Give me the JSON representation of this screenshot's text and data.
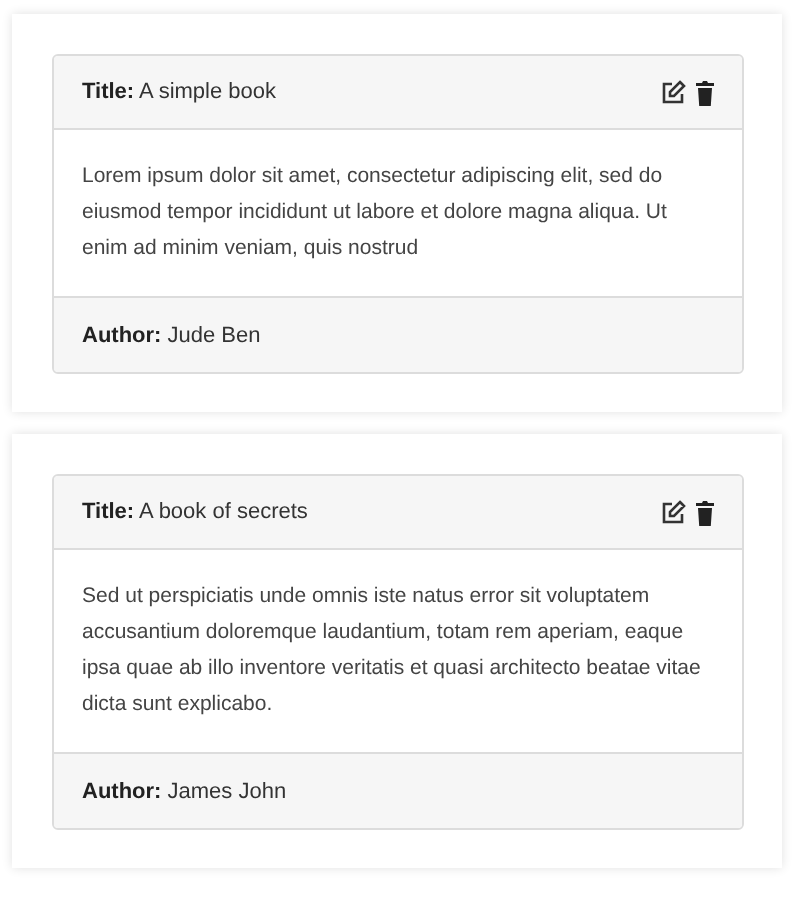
{
  "books": [
    {
      "title": "**Title:** A simple book",
      "description": "Lorem ipsum dolor sit amet, consectetur adipiscing elit, sed do eiusmod tempor incididunt ut labore et dolore magna aliqua. Ut enim ad minim veniam, quis nostrud",
      "author": "**Author:** Jude Ben"
    },
    {
      "title": "**Title:** A book of secrets",
      "description": "Sed ut perspiciatis unde omnis iste natus error sit voluptatem accusantium doloremque laudantium, totam rem aperiam, eaque ipsa quae ab illo inventore veritatis et quasi architecto beatae vitae dicta sunt explicabo.",
      "author": "**Author:** James John"
    }
  ]
}
